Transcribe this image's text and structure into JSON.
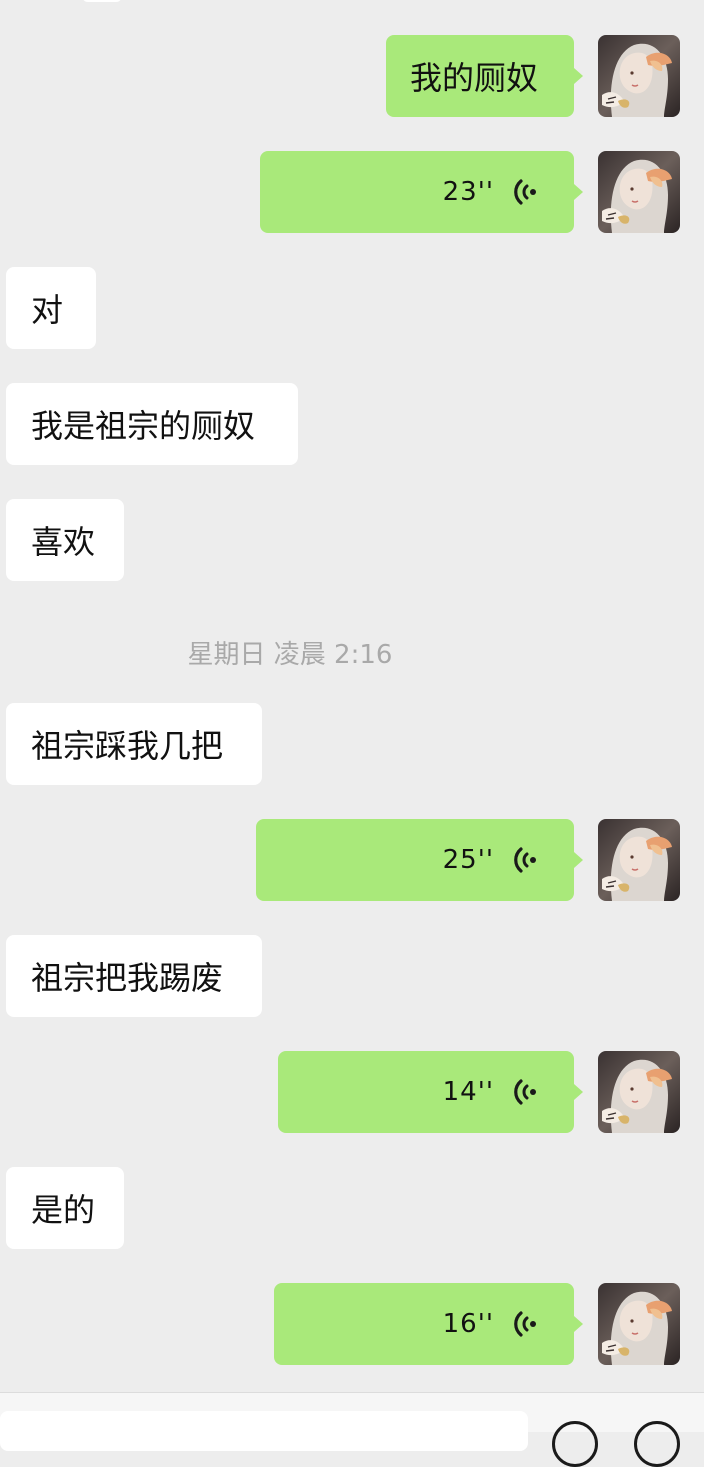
{
  "messages": [
    {
      "side": "out",
      "type": "text",
      "text": "我的厕奴"
    },
    {
      "side": "out",
      "type": "voice",
      "duration": "23''"
    },
    {
      "side": "in",
      "type": "text",
      "text": "对"
    },
    {
      "side": "in",
      "type": "text",
      "text": "我是祖宗的厕奴"
    },
    {
      "side": "in",
      "type": "text",
      "text": "喜欢"
    },
    {
      "side": "in",
      "type": "text",
      "text": "祖宗踩我几把"
    },
    {
      "side": "out",
      "type": "voice",
      "duration": "25''"
    },
    {
      "side": "in",
      "type": "text",
      "text": "祖宗把我踢废"
    },
    {
      "side": "out",
      "type": "voice",
      "duration": "14''"
    },
    {
      "side": "in",
      "type": "text",
      "text": "是的"
    },
    {
      "side": "out",
      "type": "voice",
      "duration": "16''"
    }
  ],
  "timestamp": "星期日 凌晨 2:16",
  "colors": {
    "background": "#ededed",
    "outgoing_bubble": "#a9e97a",
    "incoming_bubble": "#ffffff",
    "timestamp_text": "#a9a9a9"
  },
  "icons": {
    "voice_playback": "voice-wave-icon",
    "avatar": "user-avatar"
  }
}
